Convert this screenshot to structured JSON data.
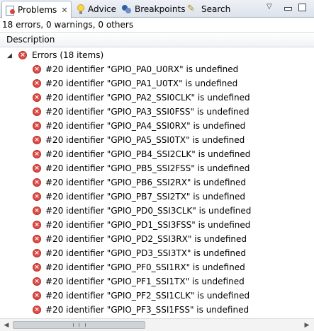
{
  "tabs": [
    {
      "label": "Problems",
      "icon": "problems-icon",
      "active": true,
      "closable": true
    },
    {
      "label": "Advice",
      "icon": "lightbulb-icon",
      "active": false
    },
    {
      "label": "Breakpoints",
      "icon": "breakpoints-icon",
      "active": false
    },
    {
      "label": "Search",
      "icon": "flashlight-icon",
      "active": false
    }
  ],
  "summary": "18 errors, 0 warnings, 0 others",
  "column_header": "Description",
  "group": {
    "label": "Errors (18 items)",
    "expanded": true
  },
  "errors": [
    "#20 identifier \"GPIO_PA0_U0RX\" is undefined",
    "#20 identifier \"GPIO_PA1_U0TX\" is undefined",
    "#20 identifier \"GPIO_PA2_SSI0CLK\" is undefined",
    "#20 identifier \"GPIO_PA3_SSI0FSS\" is undefined",
    "#20 identifier \"GPIO_PA4_SSI0RX\" is undefined",
    "#20 identifier \"GPIO_PA5_SSI0TX\" is undefined",
    "#20 identifier \"GPIO_PB4_SSI2CLK\" is undefined",
    "#20 identifier \"GPIO_PB5_SSI2FSS\" is undefined",
    "#20 identifier \"GPIO_PB6_SSI2RX\" is undefined",
    "#20 identifier \"GPIO_PB7_SSI2TX\" is undefined",
    "#20 identifier \"GPIO_PD0_SSI3CLK\" is undefined",
    "#20 identifier \"GPIO_PD1_SSI3FSS\" is undefined",
    "#20 identifier \"GPIO_PD2_SSI3RX\" is undefined",
    "#20 identifier \"GPIO_PD3_SSI3TX\" is undefined",
    "#20 identifier \"GPIO_PF0_SSI1RX\" is undefined",
    "#20 identifier \"GPIO_PF1_SSI1TX\" is undefined",
    "#20 identifier \"GPIO_PF2_SSI1CLK\" is undefined",
    "#20 identifier \"GPIO_PF3_SSI1FSS\" is undefined"
  ],
  "colors": {
    "error": "#e04b45",
    "tab_border": "#a9b4c4"
  }
}
